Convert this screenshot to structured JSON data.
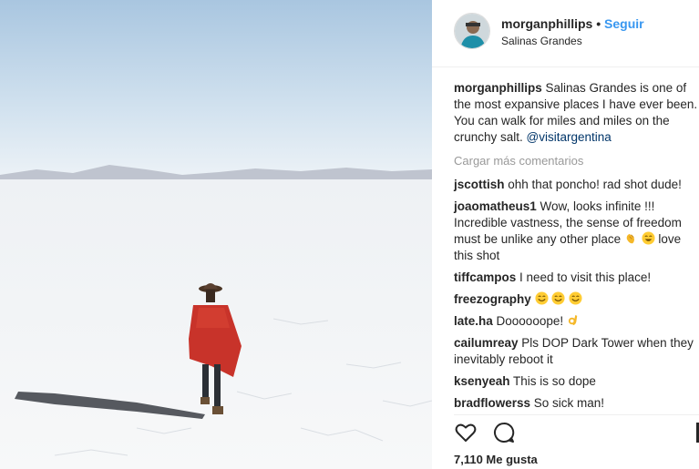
{
  "post": {
    "username": "morganphillips",
    "separator": "•",
    "follow_label": "Seguir",
    "location": "Salinas Grandes",
    "caption": {
      "username": "morganphillips",
      "text": " Salinas Grandes is one of the most expansive places I have ever been. You can walk for miles and miles on the crunchy salt. ",
      "mention": "@visitargentina"
    },
    "load_more_label": "Cargar más comentarios",
    "comments": [
      {
        "user": "jscottish",
        "text": " ohh that poncho! rad shot dude!"
      },
      {
        "user": "joaomatheus1",
        "text": " Wow, looks infinite !!! Incredible vastness, the sense of freedom must be unlike any other place ",
        "emoji": [
          "clapping-hands-icon",
          "smiling-face-icon"
        ],
        "text_after": " love this shot"
      },
      {
        "user": "tiffcampos",
        "text": " I need to visit this place!"
      },
      {
        "user": "freezography",
        "text": " ",
        "emoji": [
          "smiling-face-icon",
          "smiling-face-icon",
          "smiling-face-icon"
        ]
      },
      {
        "user": "late.ha",
        "text": " Doooooope! ",
        "emoji": [
          "ok-hand-icon"
        ]
      },
      {
        "user": "cailumreay",
        "text": " Pls DOP Dark Tower when they inevitably reboot it"
      },
      {
        "user": "ksenyeah",
        "text": " This is so dope"
      },
      {
        "user": "bradflowerss",
        "text": " So sick man!"
      }
    ],
    "actions": {
      "like_icon": "heart-icon",
      "comment_icon": "comment-icon"
    },
    "likes_label": "7,110 Me gusta"
  },
  "colors": {
    "link": "#3897f0",
    "mention": "#003569",
    "text": "#262626",
    "muted": "#999999"
  }
}
